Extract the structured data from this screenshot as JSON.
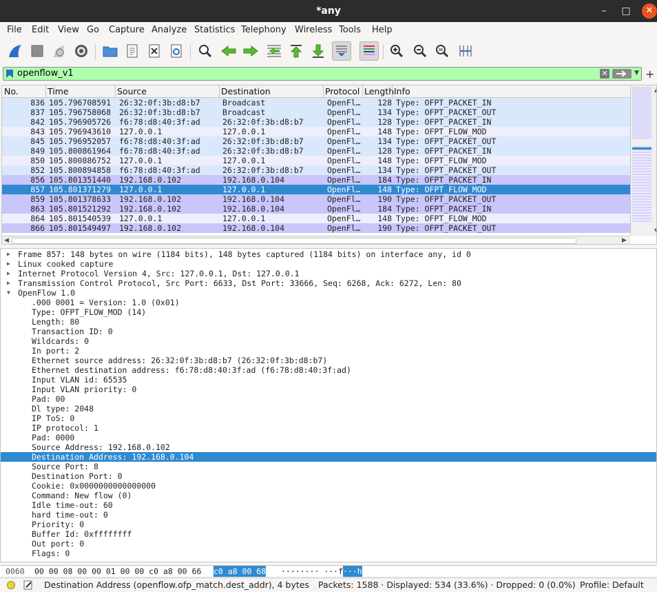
{
  "window": {
    "title": "*any"
  },
  "menu": [
    "File",
    "Edit",
    "View",
    "Go",
    "Capture",
    "Analyze",
    "Statistics",
    "Telephony",
    "Wireless",
    "Tools",
    "Help"
  ],
  "filter": {
    "value": "openflow_v1"
  },
  "packet_list": {
    "columns": [
      "No.",
      "Time",
      "Source",
      "Destination",
      "Protocol",
      "Length",
      "Info"
    ],
    "rows": [
      {
        "no": "836",
        "time": "105.796708591",
        "src": "26:32:0f:3b:d8:b7",
        "dst": "Broadcast",
        "proto": "OpenFl…",
        "len": "128",
        "info": "Type: OFPT_PACKET_IN"
      },
      {
        "no": "837",
        "time": "105.796758068",
        "src": "26:32:0f:3b:d8:b7",
        "dst": "Broadcast",
        "proto": "OpenFl…",
        "len": "134",
        "info": "Type: OFPT_PACKET_OUT"
      },
      {
        "no": "842",
        "time": "105.796905726",
        "src": "f6:78:d8:40:3f:ad",
        "dst": "26:32:0f:3b:d8:b7",
        "proto": "OpenFl…",
        "len": "128",
        "info": "Type: OFPT_PACKET_IN"
      },
      {
        "no": "843",
        "time": "105.796943610",
        "src": "127.0.0.1",
        "dst": "127.0.0.1",
        "proto": "OpenFl…",
        "len": "148",
        "info": "Type: OFPT_FLOW_MOD"
      },
      {
        "no": "845",
        "time": "105.796952057",
        "src": "f6:78:d8:40:3f:ad",
        "dst": "26:32:0f:3b:d8:b7",
        "proto": "OpenFl…",
        "len": "134",
        "info": "Type: OFPT_PACKET_OUT"
      },
      {
        "no": "849",
        "time": "105.800861964",
        "src": "f6:78:d8:40:3f:ad",
        "dst": "26:32:0f:3b:d8:b7",
        "proto": "OpenFl…",
        "len": "128",
        "info": "Type: OFPT_PACKET_IN"
      },
      {
        "no": "850",
        "time": "105.800886752",
        "src": "127.0.0.1",
        "dst": "127.0.0.1",
        "proto": "OpenFl…",
        "len": "148",
        "info": "Type: OFPT_FLOW_MOD"
      },
      {
        "no": "852",
        "time": "105.800894858",
        "src": "f6:78:d8:40:3f:ad",
        "dst": "26:32:0f:3b:d8:b7",
        "proto": "OpenFl…",
        "len": "134",
        "info": "Type: OFPT_PACKET_OUT"
      },
      {
        "no": "856",
        "time": "105.801351440",
        "src": "192.168.0.102",
        "dst": "192.168.0.104",
        "proto": "OpenFl…",
        "len": "184",
        "info": "Type: OFPT_PACKET_IN"
      },
      {
        "no": "857",
        "time": "105.801371279",
        "src": "127.0.0.1",
        "dst": "127.0.0.1",
        "proto": "OpenFl…",
        "len": "148",
        "info": "Type: OFPT_FLOW_MOD"
      },
      {
        "no": "859",
        "time": "105.801378633",
        "src": "192.168.0.102",
        "dst": "192.168.0.104",
        "proto": "OpenFl…",
        "len": "190",
        "info": "Type: OFPT_PACKET_OUT"
      },
      {
        "no": "863",
        "time": "105.801521292",
        "src": "192.168.0.102",
        "dst": "192.168.0.104",
        "proto": "OpenFl…",
        "len": "184",
        "info": "Type: OFPT_PACKET_IN"
      },
      {
        "no": "864",
        "time": "105.801540539",
        "src": "127.0.0.1",
        "dst": "127.0.0.1",
        "proto": "OpenFl…",
        "len": "148",
        "info": "Type: OFPT_FLOW_MOD"
      },
      {
        "no": "866",
        "time": "105.801549497",
        "src": "192.168.0.102",
        "dst": "192.168.0.104",
        "proto": "OpenFl…",
        "len": "190",
        "info": "Type: OFPT_PACKET_OUT"
      }
    ]
  },
  "details": {
    "top": [
      "Frame 857: 148 bytes on wire (1184 bits), 148 bytes captured (1184 bits) on interface any, id 0",
      "Linux cooked capture",
      "Internet Protocol Version 4, Src: 127.0.0.1, Dst: 127.0.0.1",
      "Transmission Control Protocol, Src Port: 6633, Dst Port: 33666, Seq: 6268, Ack: 6272, Len: 80",
      "OpenFlow 1.0"
    ],
    "openflow_fields": [
      ".000 0001 = Version: 1.0 (0x01)",
      "Type: OFPT_FLOW_MOD (14)",
      "Length: 80",
      "Transaction ID: 0",
      "Wildcards: 0",
      "In port: 2",
      "Ethernet source address: 26:32:0f:3b:d8:b7 (26:32:0f:3b:d8:b7)",
      "Ethernet destination address: f6:78:d8:40:3f:ad (f6:78:d8:40:3f:ad)",
      "Input VLAN id: 65535",
      "Input VLAN priority: 0",
      "Pad: 00",
      "Dl type: 2048",
      "IP ToS: 0",
      "IP protocol: 1",
      "Pad: 0000",
      "Source Address: 192.168.0.102",
      "Destination Address: 192.168.0.104",
      "Source Port: 8",
      "Destination Port: 0",
      "Cookie: 0x0000000000000000",
      "Command: New flow (0)",
      "Idle time-out: 60",
      "hard time-out: 0",
      "Priority: 0",
      "Buffer Id: 0xffffffff",
      "Out port: 0",
      "Flags: 0"
    ]
  },
  "bytes": {
    "offset": "0060",
    "hex": "00 00 08 00 00 01 00 00  c0 a8 00 66",
    "hex_hl": "c0 a8 00 68",
    "ascii": "········ ···f",
    "ascii_hl": "···h"
  },
  "status": {
    "field": "Destination Address (openflow.ofp_match.dest_addr), 4 bytes",
    "packets": "Packets: 1588 · Displayed: 534 (33.6%) · Dropped: 0 (0.0%)",
    "profile": "Profile: Default"
  },
  "colors": {
    "selection": "#2f8ad0",
    "filter_valid": "#afffaf",
    "close_button": "#e95420"
  }
}
